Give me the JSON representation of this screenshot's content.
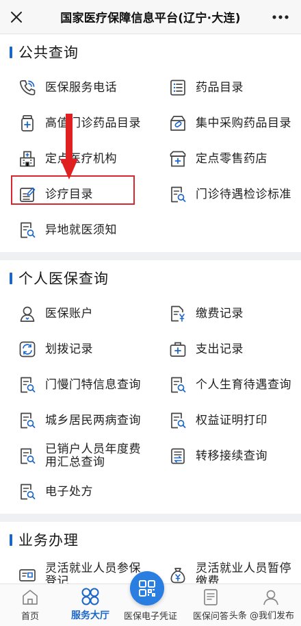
{
  "header": {
    "title": "国家医疗保障信息平台(辽宁·大连)"
  },
  "sections": [
    {
      "title": "公共查询",
      "items": [
        {
          "label": "医保服务电话",
          "icon": "phone-icon"
        },
        {
          "label": "药品目录",
          "icon": "list-icon"
        },
        {
          "label": "高值门诊药品目录",
          "icon": "medicine-bottle-icon"
        },
        {
          "label": "集中采购药品目录",
          "icon": "medicine-box-icon"
        },
        {
          "label": "定点医疗机构",
          "icon": "hospital-icon"
        },
        {
          "label": "定点零售药店",
          "icon": "pharmacy-icon"
        },
        {
          "label": "诊疗目录",
          "icon": "edit-doc-icon"
        },
        {
          "label": "门诊待遇检诊标准",
          "icon": "doc-search-icon"
        },
        {
          "label": "异地就医须知",
          "icon": "doc-search-icon"
        }
      ]
    },
    {
      "title": "个人医保查询",
      "items": [
        {
          "label": "医保账户",
          "icon": "user-icon"
        },
        {
          "label": "缴费记录",
          "icon": "payment-doc-icon"
        },
        {
          "label": "划拨记录",
          "icon": "transfer-icon"
        },
        {
          "label": "支出记录",
          "icon": "medical-kit-icon"
        },
        {
          "label": "门慢门特信息查询",
          "icon": "doc-search-icon"
        },
        {
          "label": "个人生育待遇查询",
          "icon": "doc-search-icon"
        },
        {
          "label": "城乡居民两病查询",
          "icon": "doc-search-icon"
        },
        {
          "label": "权益证明打印",
          "icon": "doc-search-icon"
        },
        {
          "label": "已销户人员年度费用汇总查询",
          "icon": "doc-search-icon"
        },
        {
          "label": "转移接续查询",
          "icon": "transfer-doc-icon"
        },
        {
          "label": "电子处方",
          "icon": "doc-search-icon"
        }
      ]
    },
    {
      "title": "业务办理",
      "items": [
        {
          "label": "灵活就业人员参保登记",
          "icon": "id-card-icon"
        },
        {
          "label": "灵活就业人员暂停缴费",
          "icon": "money-bag-icon"
        }
      ]
    }
  ],
  "bottom_nav": [
    {
      "label": "首页",
      "icon": "home-icon"
    },
    {
      "label": "服务大厅",
      "icon": "clover-icon",
      "active": true
    },
    {
      "label": "医保电子凭证",
      "icon": "qr-code-icon"
    },
    {
      "label": "医保问答",
      "icon": "qa-icon"
    },
    {
      "label": "我的",
      "icon": "profile-icon"
    }
  ],
  "watermark": "头条 @我们发布",
  "colors": {
    "accent": "#1a66c9",
    "highlight": "#d9262c",
    "fab": "#2a7de1"
  }
}
